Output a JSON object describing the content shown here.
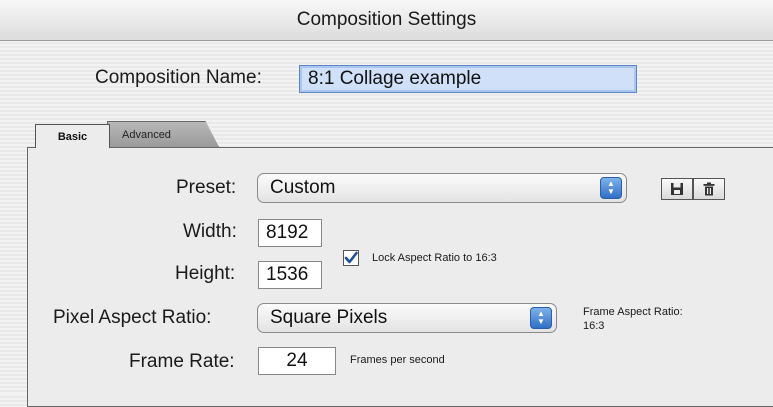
{
  "window": {
    "title": "Composition Settings"
  },
  "composition": {
    "name_label": "Composition Name:",
    "name_value": "8:1 Collage example"
  },
  "tabs": [
    {
      "label": "Basic"
    },
    {
      "label": "Advanced"
    }
  ],
  "preset": {
    "label": "Preset:",
    "value": "Custom"
  },
  "width": {
    "label": "Width:",
    "value": "8192"
  },
  "height": {
    "label": "Height:",
    "value": "1536"
  },
  "lock": {
    "label": "Lock Aspect Ratio to 16:3",
    "checked": true
  },
  "pixel_aspect": {
    "label": "Pixel Aspect Ratio:",
    "value": "Square Pixels"
  },
  "frame_aspect": {
    "line1": "Frame Aspect Ratio:",
    "line2": "16:3"
  },
  "frame_rate": {
    "label": "Frame Rate:",
    "value": "24",
    "unit": "Frames per second"
  },
  "icons": {
    "save": "floppy-disk-icon",
    "delete": "trash-icon",
    "popup": "up-down-arrow-icon",
    "check": "checkmark-icon"
  }
}
